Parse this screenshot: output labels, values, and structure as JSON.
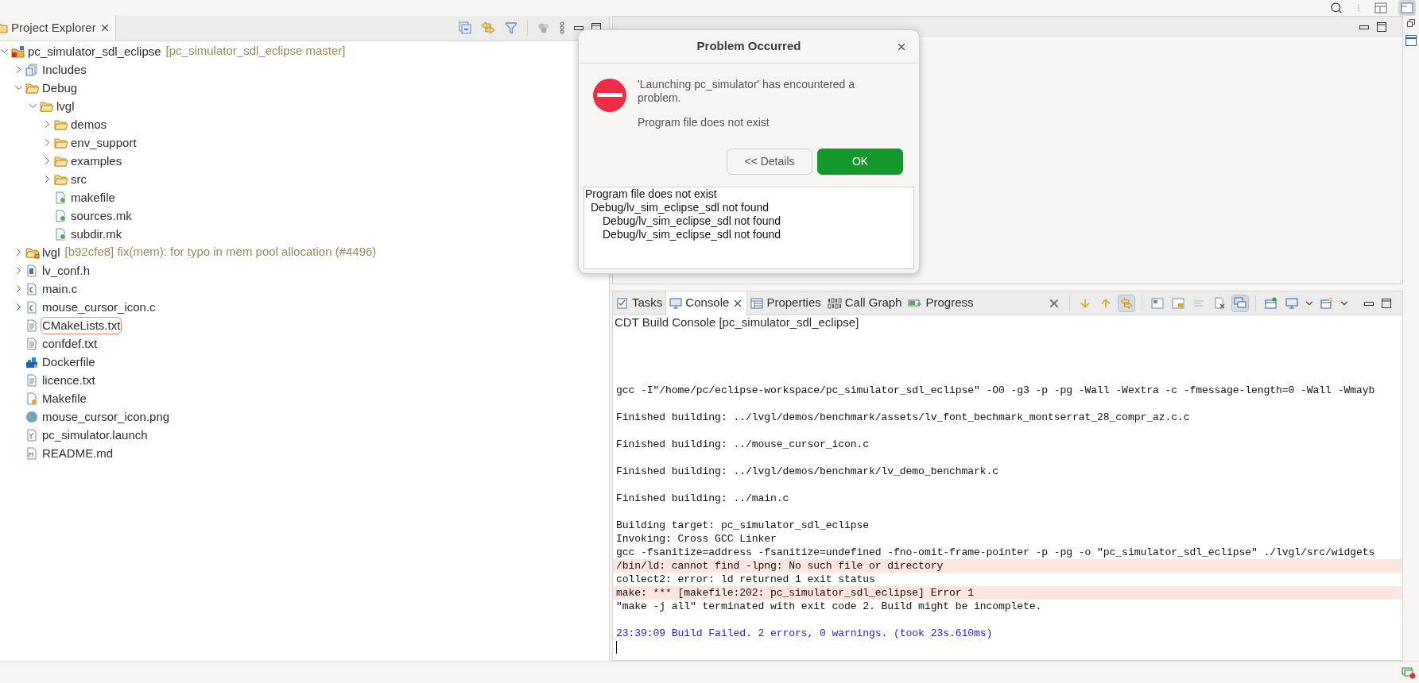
{
  "project_explorer": {
    "tab": {
      "label": "Project Explorer",
      "selected": true
    },
    "tree": [
      {
        "label": "pc_simulator_sdl_eclipse",
        "decoration": "[pc_simulator_sdl_eclipse master]",
        "kind": "project",
        "expanded": true,
        "highlighted": false,
        "children": [
          {
            "label": "Includes",
            "kind": "includes",
            "expanded": false,
            "highlighted": false
          },
          {
            "label": "Debug",
            "kind": "folder",
            "expanded": true,
            "highlighted": false,
            "children": [
              {
                "label": "lvgl",
                "kind": "folder",
                "expanded": true,
                "highlighted": false,
                "children": [
                  {
                    "label": "demos",
                    "kind": "folder",
                    "expanded": false,
                    "highlighted": false
                  },
                  {
                    "label": "env_support",
                    "kind": "folder",
                    "expanded": false,
                    "highlighted": false
                  },
                  {
                    "label": "examples",
                    "kind": "folder",
                    "expanded": false,
                    "highlighted": false
                  },
                  {
                    "label": "src",
                    "kind": "folder",
                    "expanded": false,
                    "highlighted": false
                  },
                  {
                    "label": "makefile",
                    "kind": "make",
                    "highlighted": false
                  },
                  {
                    "label": "sources.mk",
                    "kind": "make",
                    "highlighted": false
                  },
                  {
                    "label": "subdir.mk",
                    "kind": "make",
                    "highlighted": false
                  }
                ]
              }
            ]
          },
          {
            "label": "lvgl",
            "decoration": "[b92cfe8] fix(mem): for typo in mem pool allocation (#4496)",
            "kind": "repo-folder",
            "expanded": false,
            "highlighted": false
          },
          {
            "label": "lv_conf.h",
            "kind": "header",
            "expanded": false,
            "highlighted": false
          },
          {
            "label": "main.c",
            "kind": "c-source",
            "expanded": false,
            "highlighted": false
          },
          {
            "label": "mouse_cursor_icon.c",
            "kind": "c-source",
            "expanded": false,
            "highlighted": false
          },
          {
            "label": "CMakeLists.txt",
            "kind": "text",
            "highlighted": true
          },
          {
            "label": "confdef.txt",
            "kind": "text",
            "highlighted": false
          },
          {
            "label": "Dockerfile",
            "kind": "docker",
            "highlighted": false
          },
          {
            "label": "licence.txt",
            "kind": "text",
            "highlighted": false
          },
          {
            "label": "Makefile",
            "kind": "make-file",
            "highlighted": false
          },
          {
            "label": "mouse_cursor_icon.png",
            "kind": "image",
            "highlighted": false
          },
          {
            "label": "pc_simulator.launch",
            "kind": "launch",
            "highlighted": false
          },
          {
            "label": "README.md",
            "kind": "markdown",
            "highlighted": false
          }
        ]
      }
    ]
  },
  "dialog": {
    "title": "Problem Occurred",
    "message": "'Launching pc_simulator' has encountered a problem.",
    "reason": "Program file does not exist",
    "buttons": [
      {
        "label": "<< Details",
        "kind": "secondary"
      },
      {
        "label": "OK",
        "kind": "primary"
      }
    ],
    "details": [
      {
        "text": "Program file does not exist",
        "children": [
          {
            "text": "Debug/lv_sim_eclipse_sdl not found",
            "children": [
              {
                "text": "Debug/lv_sim_eclipse_sdl not found"
              },
              {
                "text": "Debug/lv_sim_eclipse_sdl not found"
              }
            ]
          }
        ]
      }
    ]
  },
  "console": {
    "tabs": [
      {
        "label": "Tasks",
        "kind": "tasks",
        "selected": false
      },
      {
        "label": "Console",
        "kind": "console",
        "selected": true
      },
      {
        "label": "Properties",
        "kind": "properties",
        "selected": false
      },
      {
        "label": "Call Graph",
        "kind": "call-graph",
        "selected": false
      },
      {
        "label": "Progress",
        "kind": "progress",
        "selected": false
      }
    ],
    "title": "CDT Build Console [pc_simulator_sdl_eclipse]",
    "lines": [
      {
        "kind": "blank"
      },
      {
        "kind": "blank"
      },
      {
        "kind": "blank"
      },
      {
        "kind": "blank"
      },
      {
        "kind": "normal",
        "text": "gcc -I\"/home/pc/eclipse-workspace/pc_simulator_sdl_eclipse\" -O0 -g3 -p -pg -Wall -Wextra -c -fmessage-length=0 -Wall -Wmayb"
      },
      {
        "kind": "blank"
      },
      {
        "kind": "normal",
        "text": "Finished building: ../lvgl/demos/benchmark/assets/lv_font_bechmark_montserrat_28_compr_az.c.c"
      },
      {
        "kind": "blank"
      },
      {
        "kind": "normal",
        "text": "Finished building: ../mouse_cursor_icon.c"
      },
      {
        "kind": "blank"
      },
      {
        "kind": "normal",
        "text": "Finished building: ../lvgl/demos/benchmark/lv_demo_benchmark.c"
      },
      {
        "kind": "blank"
      },
      {
        "kind": "normal",
        "text": "Finished building: ../main.c"
      },
      {
        "kind": "blank"
      },
      {
        "kind": "normal",
        "text": "Building target: pc_simulator_sdl_eclipse"
      },
      {
        "kind": "normal",
        "text": "Invoking: Cross GCC Linker"
      },
      {
        "kind": "normal",
        "text": "gcc -fsanitize=address -fsanitize=undefined -fno-omit-frame-pointer -p -pg -o \"pc_simulator_sdl_eclipse\" ./lvgl/src/widgets"
      },
      {
        "kind": "error",
        "text": "/bin/ld: cannot find -lpng: No such file or directory"
      },
      {
        "kind": "normal",
        "text": "collect2: error: ld returned 1 exit status"
      },
      {
        "kind": "error",
        "text": "make: *** [makefile:202: pc_simulator_sdl_eclipse] Error 1"
      },
      {
        "kind": "normal",
        "text": "\"make -j all\" terminated with exit code 2. Build might be incomplete."
      },
      {
        "kind": "blank"
      },
      {
        "kind": "info",
        "text": "23:39:09 Build Failed. 2 errors, 0 warnings. (took 23s.610ms)"
      }
    ]
  }
}
